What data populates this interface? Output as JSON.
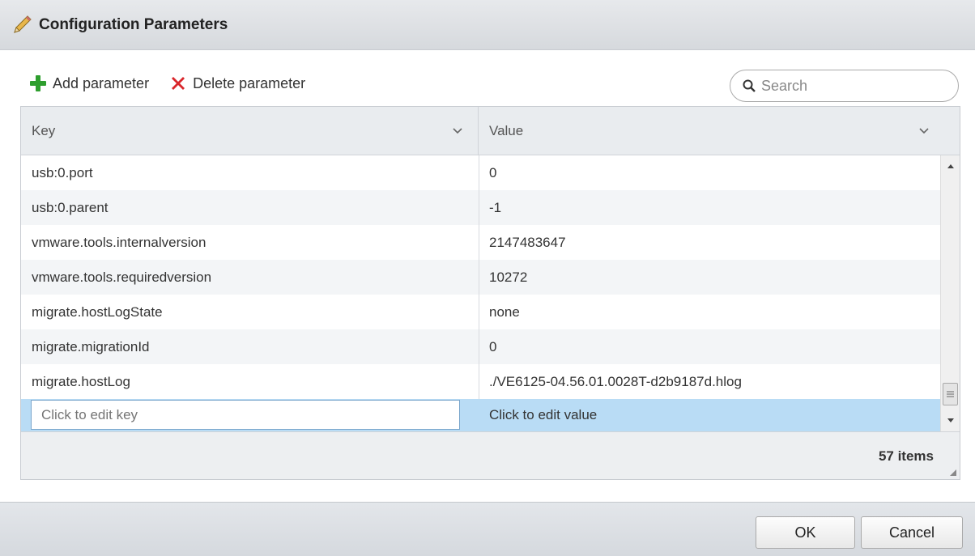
{
  "dialog": {
    "title": "Configuration Parameters"
  },
  "toolbar": {
    "add_label": "Add parameter",
    "delete_label": "Delete parameter"
  },
  "search": {
    "placeholder": "Search"
  },
  "grid": {
    "columns": {
      "key": "Key",
      "value": "Value"
    },
    "rows": [
      {
        "key": "usb:0.port",
        "value": "0"
      },
      {
        "key": "usb:0.parent",
        "value": "-1"
      },
      {
        "key": "vmware.tools.internalversion",
        "value": "2147483647"
      },
      {
        "key": "vmware.tools.requiredversion",
        "value": "10272"
      },
      {
        "key": "migrate.hostLogState",
        "value": "none"
      },
      {
        "key": "migrate.migrationId",
        "value": "0"
      },
      {
        "key": "migrate.hostLog",
        "value": "./VE6125-04.56.01.0028T-d2b9187d.hlog"
      }
    ],
    "edit_row": {
      "key_placeholder": "Click to edit key",
      "value_placeholder": "Click to edit value"
    },
    "item_count": "57 items"
  },
  "buttons": {
    "ok": "OK",
    "cancel": "Cancel"
  },
  "colors": {
    "selected_row": "#b9dcf5",
    "add_icon": "#2e9e2e",
    "delete_icon": "#d9262b"
  }
}
